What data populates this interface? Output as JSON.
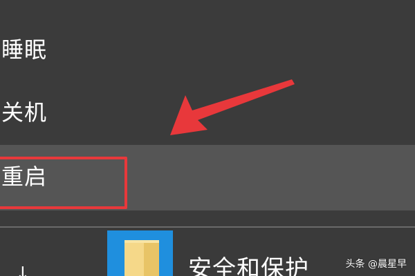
{
  "power_menu": {
    "items": [
      {
        "label": "睡眠"
      },
      {
        "label": "关机"
      },
      {
        "label": "重启"
      }
    ],
    "hover_item": "重启"
  },
  "start_menu": {
    "tile_label": "安全和保护",
    "tile_icon": "folder-icon",
    "tile_color": "#1f8fde",
    "partial_glyph": "↓"
  },
  "annotation": {
    "highlight_color": "#e8383b",
    "arrow_color": "#e8383b"
  },
  "watermark": {
    "text": "头条 @晨星早"
  }
}
